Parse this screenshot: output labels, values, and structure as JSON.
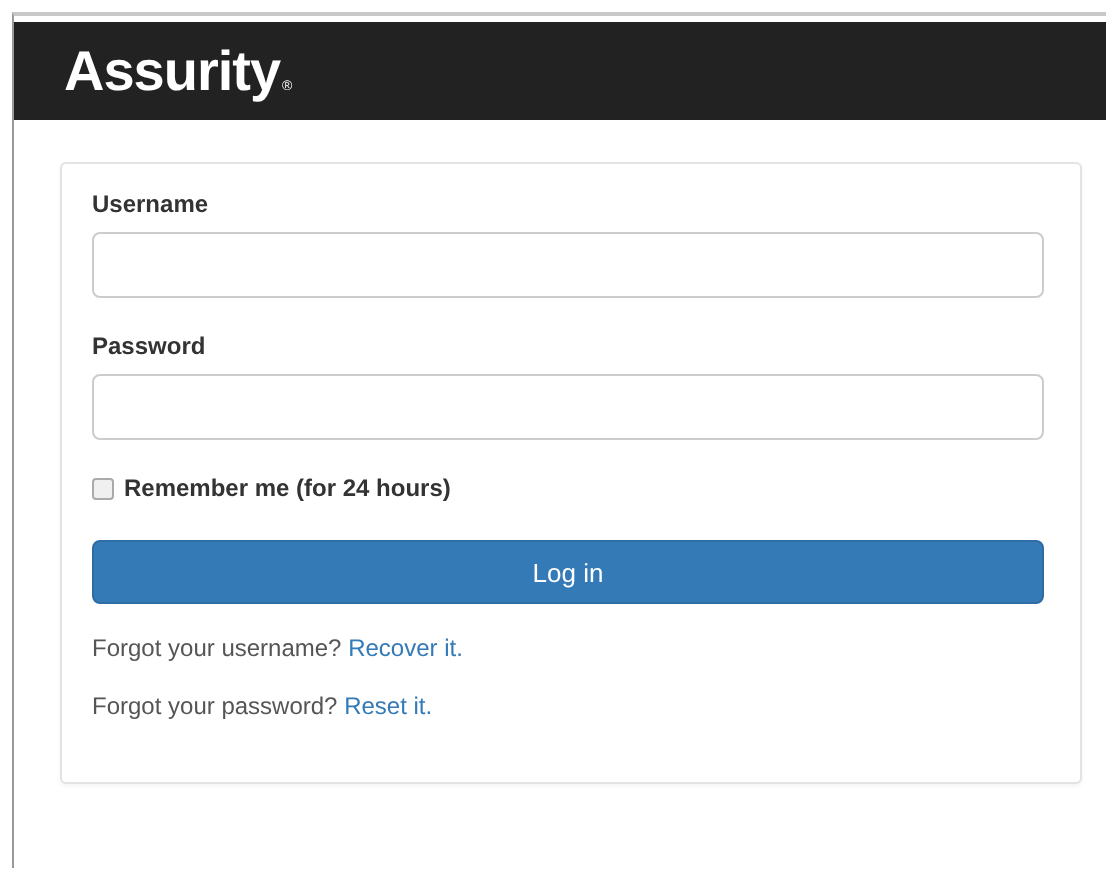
{
  "header": {
    "logo": "Assurity",
    "logo_mark": "®"
  },
  "form": {
    "fields": [
      {
        "label": "Username"
      },
      {
        "label": "Password"
      }
    ],
    "remember": {
      "label": "Remember me (for 24 hours)",
      "checked": false
    },
    "submit": "Log in",
    "help_links": [
      {
        "prompt": "Forgot your username?",
        "link": "Recover it."
      },
      {
        "prompt": "Forgot your password?",
        "link": "Reset it."
      }
    ]
  }
}
